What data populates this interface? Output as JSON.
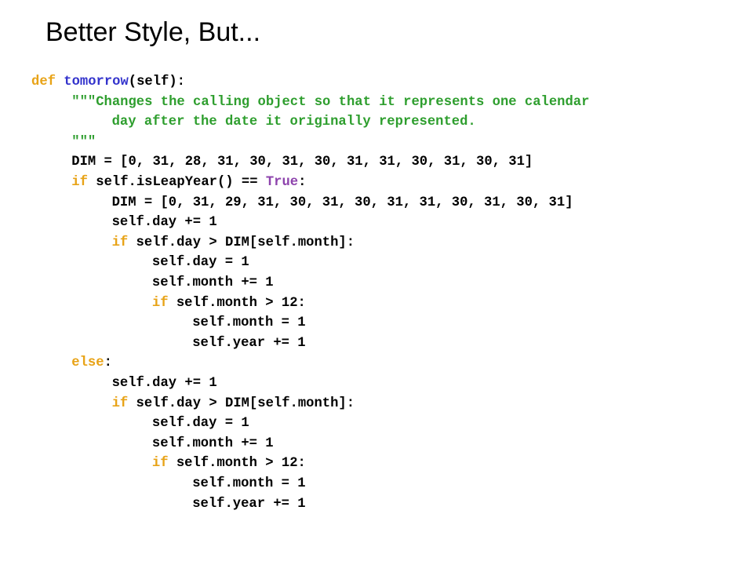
{
  "slide": {
    "title": "Better Style, But..."
  },
  "colors": {
    "keyword": "#E8A317",
    "function_name": "#3333CC",
    "docstring": "#2E9E2E",
    "builtin_constant": "#8E44AD",
    "plain": "#000000"
  },
  "code": {
    "lines": [
      {
        "indent": 0,
        "tokens": [
          {
            "text": "def",
            "color": "#E8A317"
          },
          {
            "text": " ",
            "color": "#000000"
          },
          {
            "text": "tomorrow",
            "color": "#3333CC"
          },
          {
            "text": "(self):",
            "color": "#000000"
          }
        ]
      },
      {
        "indent": 1,
        "tokens": [
          {
            "text": "\"\"\"Changes the calling object so that it represents one calendar",
            "color": "#2E9E2E"
          }
        ]
      },
      {
        "indent": 2,
        "tokens": [
          {
            "text": "day after the date it originally represented.",
            "color": "#2E9E2E"
          }
        ]
      },
      {
        "indent": 1,
        "tokens": [
          {
            "text": "\"\"\"",
            "color": "#2E9E2E"
          }
        ]
      },
      {
        "indent": 1,
        "tokens": [
          {
            "text": "DIM = [0, 31, 28, 31, 30, 31, 30, 31, 31, 30, 31, 30, 31]",
            "color": "#000000"
          }
        ]
      },
      {
        "indent": 1,
        "tokens": [
          {
            "text": "if",
            "color": "#E8A317"
          },
          {
            "text": " self.isLeapYear() == ",
            "color": "#000000"
          },
          {
            "text": "True",
            "color": "#8E44AD"
          },
          {
            "text": ":",
            "color": "#000000"
          }
        ]
      },
      {
        "indent": 2,
        "tokens": [
          {
            "text": "DIM = [0, 31, 29, 31, 30, 31, 30, 31, 31, 30, 31, 30, 31]",
            "color": "#000000"
          }
        ]
      },
      {
        "indent": 2,
        "tokens": [
          {
            "text": "self.day += 1",
            "color": "#000000"
          }
        ]
      },
      {
        "indent": 2,
        "tokens": [
          {
            "text": "if",
            "color": "#E8A317"
          },
          {
            "text": " self.day > DIM[self.month]:",
            "color": "#000000"
          }
        ]
      },
      {
        "indent": 3,
        "tokens": [
          {
            "text": "self.day = 1",
            "color": "#000000"
          }
        ]
      },
      {
        "indent": 3,
        "tokens": [
          {
            "text": "self.month += 1",
            "color": "#000000"
          }
        ]
      },
      {
        "indent": 3,
        "tokens": [
          {
            "text": "if",
            "color": "#E8A317"
          },
          {
            "text": " self.month > 12:",
            "color": "#000000"
          }
        ]
      },
      {
        "indent": 4,
        "tokens": [
          {
            "text": "self.month = 1",
            "color": "#000000"
          }
        ]
      },
      {
        "indent": 4,
        "tokens": [
          {
            "text": "self.year += 1",
            "color": "#000000"
          }
        ]
      },
      {
        "indent": 1,
        "tokens": [
          {
            "text": "else",
            "color": "#E8A317"
          },
          {
            "text": ":",
            "color": "#000000"
          }
        ]
      },
      {
        "indent": 2,
        "tokens": [
          {
            "text": "self.day += 1",
            "color": "#000000"
          }
        ]
      },
      {
        "indent": 2,
        "tokens": [
          {
            "text": "if",
            "color": "#E8A317"
          },
          {
            "text": " self.day > DIM[self.month]:",
            "color": "#000000"
          }
        ]
      },
      {
        "indent": 3,
        "tokens": [
          {
            "text": "self.day = 1",
            "color": "#000000"
          }
        ]
      },
      {
        "indent": 3,
        "tokens": [
          {
            "text": "self.month += 1",
            "color": "#000000"
          }
        ]
      },
      {
        "indent": 3,
        "tokens": [
          {
            "text": "if",
            "color": "#E8A317"
          },
          {
            "text": " self.month > 12:",
            "color": "#000000"
          }
        ]
      },
      {
        "indent": 4,
        "tokens": [
          {
            "text": "self.month = 1",
            "color": "#000000"
          }
        ]
      },
      {
        "indent": 4,
        "tokens": [
          {
            "text": "self.year += 1",
            "color": "#000000"
          }
        ]
      }
    ]
  }
}
